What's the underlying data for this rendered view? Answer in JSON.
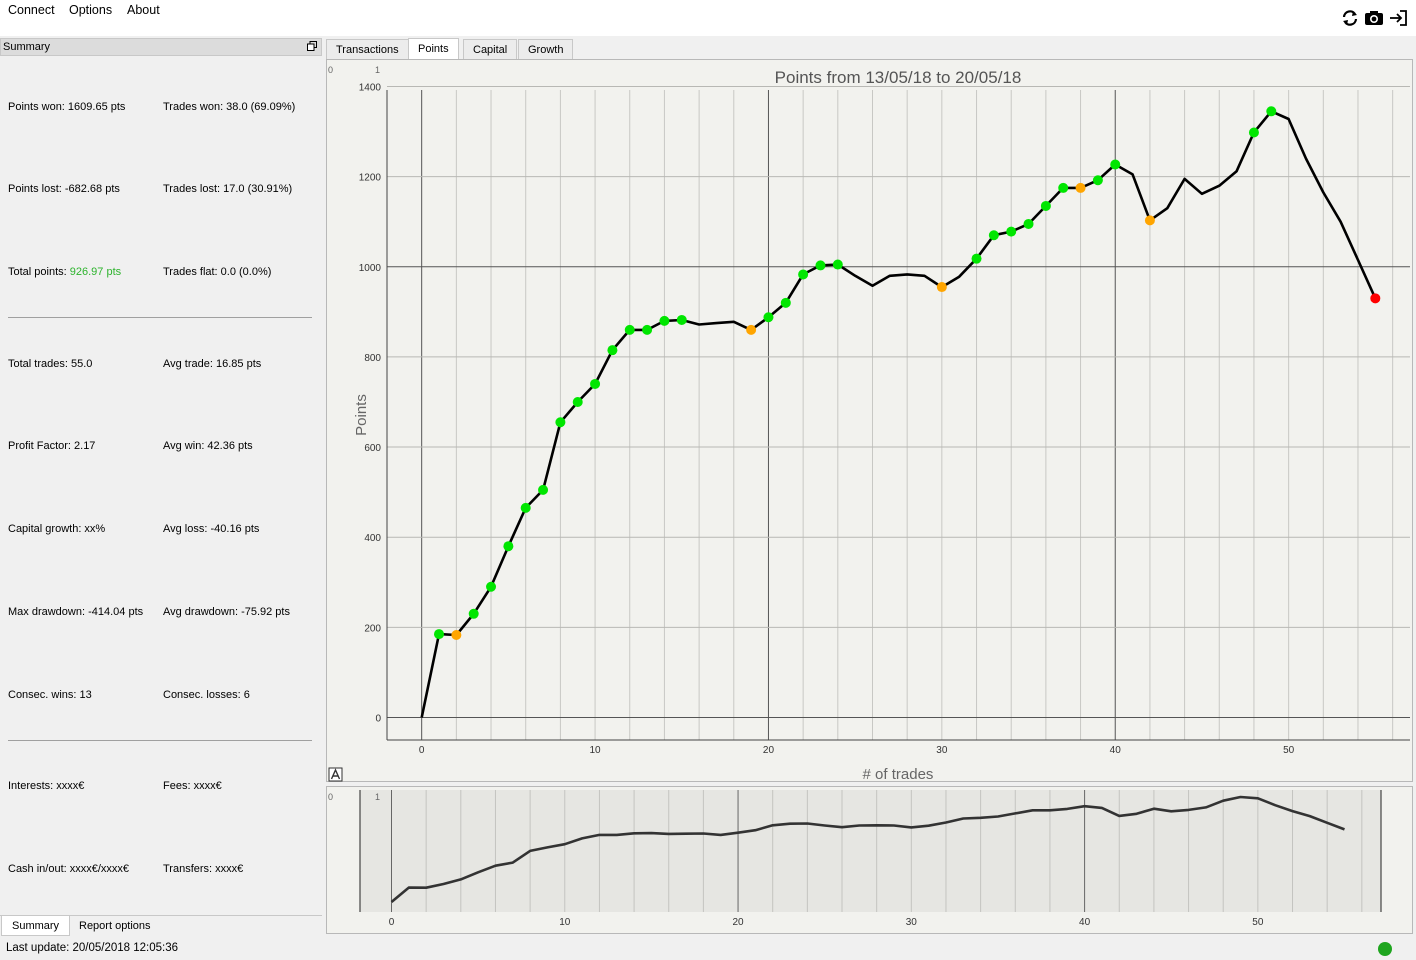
{
  "menu": {
    "connect": "Connect",
    "options": "Options",
    "about": "About"
  },
  "toolbar": {
    "icons": [
      "refresh-icon",
      "camera-icon",
      "export-icon"
    ]
  },
  "sidebar": {
    "title": "Summary",
    "stats": {
      "points_won": "Points won: 1609.65 pts",
      "trades_won": "Trades won: 38.0 (69.09%)",
      "points_lost": "Points lost: -682.68 pts",
      "trades_lost": "Trades lost: 17.0 (30.91%)",
      "total_points_label": "Total points: ",
      "total_points_value": "926.97 pts",
      "trades_flat": "Trades flat: 0.0 (0.0%)",
      "total_trades": "Total trades: 55.0",
      "avg_trade": "Avg trade: 16.85 pts",
      "profit_factor": "Profit Factor: 2.17",
      "avg_win": "Avg win: 42.36 pts",
      "capital_growth": "Capital growth: xx%",
      "avg_loss": "Avg loss: -40.16 pts",
      "max_drawdown": "Max drawdown: -414.04 pts",
      "avg_drawdown": "Avg drawdown: -75.92 pts",
      "consec_wins": "Consec. wins: 13",
      "consec_losses": "Consec. losses: 6",
      "interests": "Interests: xxxx€",
      "fees": "Fees: xxxx€",
      "cash_in_out": "Cash in/out: xxxx€/xxxx€",
      "transfers": "Transfers: xxxx€"
    },
    "bottom_tabs": [
      "Summary",
      "Report options"
    ]
  },
  "tabs": [
    "Transactions",
    "Points",
    "Capital",
    "Growth"
  ],
  "active_tab": "Points",
  "status": {
    "last_update": "Last update: 20/05/2018 12:05:36"
  },
  "colors": {
    "win": "#00e600",
    "flat": "#ffa500",
    "last": "#ff0000",
    "line": "#000000",
    "total_points": "#2db32d"
  },
  "chart_data": {
    "type": "line",
    "title": "Points from 13/05/18 to 20/05/18",
    "xlabel": "# of trades",
    "ylabel": "Points",
    "xlim": [
      -2,
      57
    ],
    "ylim": [
      -50,
      1410
    ],
    "x_ticks": [
      0,
      10,
      20,
      30,
      40,
      50
    ],
    "y_ticks": [
      0,
      200,
      400,
      600,
      800,
      1000,
      1200,
      1400
    ],
    "corner_labels": [
      "0",
      "1"
    ],
    "series": [
      {
        "x": [
          0,
          1,
          2,
          3,
          4,
          5,
          6,
          7,
          8,
          9,
          10,
          11,
          12,
          13,
          14,
          15,
          16,
          17,
          18,
          19,
          20,
          21,
          22,
          23,
          24,
          25,
          26,
          27,
          28,
          29,
          30,
          31,
          32,
          33,
          34,
          35,
          36,
          37,
          38,
          39,
          40,
          41,
          42,
          43,
          44,
          45,
          46,
          47,
          48,
          49,
          50,
          51,
          52,
          53,
          54,
          55
        ],
        "y": [
          0,
          185,
          183,
          230,
          290,
          380,
          465,
          505,
          655,
          700,
          740,
          815,
          860,
          860,
          880,
          882,
          872,
          875,
          878,
          860,
          888,
          920,
          983,
          1003,
          1005,
          980,
          958,
          980,
          983,
          980,
          955,
          978,
          1018,
          1070,
          1078,
          1095,
          1135,
          1175,
          1175,
          1192,
          1227,
          1205,
          1103,
          1130,
          1195,
          1162,
          1180,
          1212,
          1298,
          1345,
          1328,
          1240,
          1165,
          1100,
          1015,
          930
        ]
      }
    ],
    "markers": {
      "green": [
        1,
        3,
        4,
        5,
        6,
        7,
        8,
        9,
        10,
        11,
        12,
        13,
        14,
        15,
        20,
        21,
        22,
        23,
        24,
        32,
        33,
        34,
        35,
        36,
        37,
        39,
        40,
        48,
        49
      ],
      "orange": [
        2,
        19,
        30,
        38,
        42
      ],
      "red": [
        55
      ]
    },
    "navigator": {
      "x_ticks": [
        0,
        10,
        20,
        30,
        40,
        50
      ],
      "corner_labels": [
        "0",
        "1"
      ]
    }
  }
}
